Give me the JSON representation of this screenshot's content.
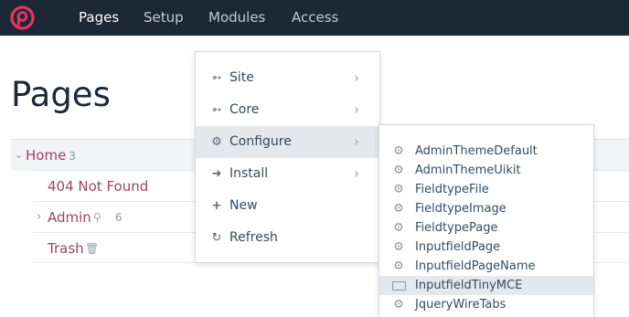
{
  "topbar": {
    "logo_icon": "processwire-logo-icon",
    "nav": [
      {
        "label": "Pages",
        "active": true
      },
      {
        "label": "Setup",
        "active": false
      },
      {
        "label": "Modules",
        "active": false
      },
      {
        "label": "Access",
        "active": false
      }
    ]
  },
  "page": {
    "title": "Pages",
    "tree": {
      "home": {
        "label": "Home",
        "count": "3"
      },
      "children": [
        {
          "label": "404 Not Found"
        },
        {
          "label": "Admin",
          "count": "6",
          "icon": "key-icon"
        },
        {
          "label": "Trash",
          "icon": "trash-icon"
        }
      ]
    }
  },
  "modules_menu": {
    "items": [
      {
        "label": "Site",
        "icon": "plug-icon",
        "has_submenu": true
      },
      {
        "label": "Core",
        "icon": "plug-icon",
        "has_submenu": true
      },
      {
        "label": "Configure",
        "icon": "gear-icon",
        "has_submenu": true,
        "highlighted": true
      },
      {
        "label": "Install",
        "icon": "sign-in-icon",
        "has_submenu": true
      },
      {
        "label": "New",
        "icon": "plus-icon",
        "has_submenu": false
      },
      {
        "label": "Refresh",
        "icon": "refresh-icon",
        "has_submenu": false
      }
    ]
  },
  "configure_submenu": {
    "items": [
      {
        "label": "AdminThemeDefault",
        "icon": "gear-icon"
      },
      {
        "label": "AdminThemeUikit",
        "icon": "gear-icon"
      },
      {
        "label": "FieldtypeFile",
        "icon": "gear-icon"
      },
      {
        "label": "FieldtypeImage",
        "icon": "gear-icon"
      },
      {
        "label": "FieldtypePage",
        "icon": "gear-icon"
      },
      {
        "label": "InputfieldPage",
        "icon": "gear-icon"
      },
      {
        "label": "InputfieldPageName",
        "icon": "gear-icon"
      },
      {
        "label": "InputfieldTinyMCE",
        "icon": "keyboard-icon",
        "highlighted": true
      },
      {
        "label": "JqueryWireTabs",
        "icon": "gear-icon"
      }
    ]
  },
  "colors": {
    "topbar_bg": "#1c2836",
    "brand": "#e83561",
    "link": "#9a4565",
    "menu_highlight": "#e3e8ed"
  }
}
